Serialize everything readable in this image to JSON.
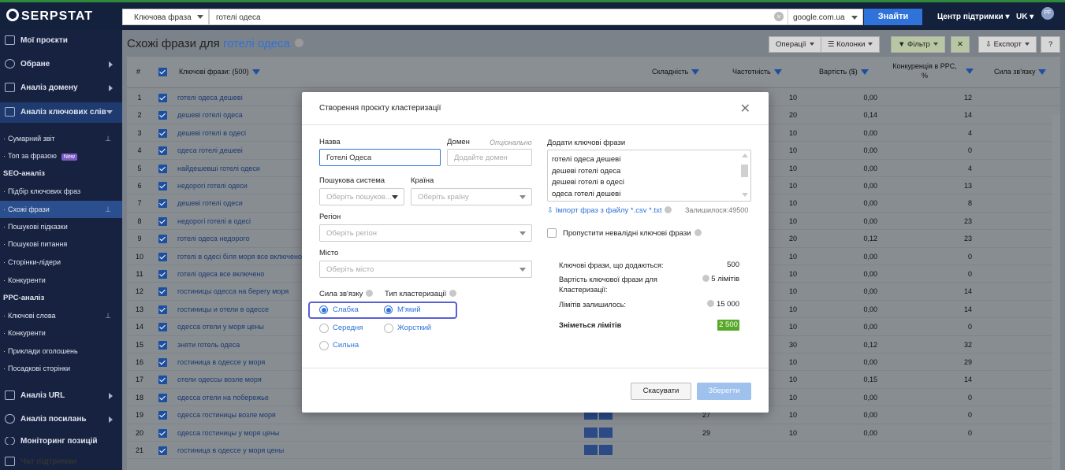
{
  "app": {
    "logo": "SERPSTAT"
  },
  "topbar": {
    "search_type": "Ключова фраза",
    "search_query": "готелі одеса",
    "search_engine": "google.com.ua",
    "find_label": "Знайти",
    "support_label": "Центр підтримки",
    "lang_label": "UK",
    "avatar": "PF"
  },
  "sidebar": {
    "my_projects": "Мої проєкти",
    "favorites": "Обране",
    "domain_analysis": "Аналіз домену",
    "keyword_analysis": "Аналіз ключових слів",
    "summary": "Сумарний звіт",
    "top_by_phrase": "Топ за фразою",
    "new_badge": "New",
    "seo_section": "SEO-аналіз",
    "keyword_selection": "Підбір ключових фраз",
    "similar_phrases": "Схожі фрази",
    "search_suggestions": "Пошукові підказки",
    "search_questions": "Пошукові питання",
    "leader_pages": "Сторінки-лідери",
    "competitors": "Конкуренти",
    "ppc_section": "PPC-аналіз",
    "keywords": "Ключові слова",
    "ppc_competitors": "Конкуренти",
    "ad_examples": "Приклади оголошень",
    "landing_pages": "Посадкові сторінки",
    "url_analysis": "Аналіз URL",
    "link_analysis": "Аналіз посилань",
    "position_monitoring": "Моніторинг позицій",
    "support_chat": "Чат підтримки"
  },
  "page": {
    "title_prefix": "Схожі фрази для",
    "title_keyword": "готелі одеса",
    "operations": "Операції",
    "columns": "Колонки",
    "filter": "Фільтр",
    "filter_clear": "✕",
    "export": "Експорт",
    "help": "?"
  },
  "table": {
    "headers": {
      "num": "#",
      "keywords": "Ключові фрази: (500)",
      "difficulty": "Складність",
      "frequency": "Частотність",
      "cost": "Вартість ($)",
      "ppc_competition": "Конкуренція в PPC, %",
      "link_strength": "Сила зв'язку"
    },
    "rows": [
      {
        "n": "1",
        "kw": "готелі одеса дешеві",
        "freq": "10",
        "cost": "0,00",
        "comp": "12"
      },
      {
        "n": "2",
        "kw": "дешеві готелі одеса",
        "freq": "20",
        "cost": "0,14",
        "comp": "14"
      },
      {
        "n": "3",
        "kw": "дешеві готелі в одесі",
        "freq": "10",
        "cost": "0,00",
        "comp": "4"
      },
      {
        "n": "4",
        "kw": "одеса готелі дешеві",
        "freq": "10",
        "cost": "0,00",
        "comp": "0"
      },
      {
        "n": "5",
        "kw": "найдешевші готелі одеси",
        "freq": "10",
        "cost": "0,00",
        "comp": "4"
      },
      {
        "n": "6",
        "kw": "недорогі готелі одеси",
        "freq": "10",
        "cost": "0,00",
        "comp": "13"
      },
      {
        "n": "7",
        "kw": "дешеві готелі одеси",
        "freq": "10",
        "cost": "0,00",
        "comp": "8"
      },
      {
        "n": "8",
        "kw": "недорогі готелі в одесі",
        "freq": "10",
        "cost": "0,00",
        "comp": "23"
      },
      {
        "n": "9",
        "kw": "готелі одеса недорого",
        "freq": "20",
        "cost": "0,12",
        "comp": "23"
      },
      {
        "n": "10",
        "kw": "готелі в одесі біля моря все включено",
        "freq": "10",
        "cost": "0,00",
        "comp": "0"
      },
      {
        "n": "11",
        "kw": "готелі одеса все включено",
        "freq": "10",
        "cost": "0,00",
        "comp": "0"
      },
      {
        "n": "12",
        "kw": "гостиницы одесса на берегу моря",
        "freq": "10",
        "cost": "0,00",
        "comp": "14"
      },
      {
        "n": "13",
        "kw": "гостиницы и отели в одессе",
        "freq": "10",
        "cost": "0,00",
        "comp": "14"
      },
      {
        "n": "14",
        "kw": "одесса отели у моря цены",
        "freq": "10",
        "cost": "0,00",
        "comp": "0"
      },
      {
        "n": "15",
        "kw": "зняти готель одеса",
        "freq": "30",
        "cost": "0,12",
        "comp": "32"
      },
      {
        "n": "16",
        "kw": "гостиница в одессе у моря",
        "freq": "10",
        "cost": "0,00",
        "comp": "29"
      },
      {
        "n": "17",
        "kw": "отели одессы возле моря",
        "freq": "10",
        "cost": "0,15",
        "comp": "14"
      },
      {
        "n": "18",
        "kw": "одесса отели на побережье",
        "freq": "10",
        "cost": "0,00",
        "comp": "0"
      },
      {
        "n": "19",
        "kw": "одесса гостиницы возле моря",
        "diff": "27",
        "freq": "10",
        "cost": "0,00",
        "comp": "0"
      },
      {
        "n": "20",
        "kw": "одесса гостиницы у моря цены",
        "diff": "29",
        "freq": "10",
        "cost": "0,00",
        "comp": "0"
      },
      {
        "n": "21",
        "kw": "гостиница в одессе у моря цены",
        "freq": "",
        "cost": "",
        "comp": ""
      }
    ]
  },
  "modal": {
    "title": "Створення проєкту кластеризації",
    "close": "✕",
    "name_label": "Назва",
    "name_value": "Готелі Одеса",
    "domain_label": "Домен",
    "domain_optional": "Опціонально",
    "domain_placeholder": "Додайте домен",
    "engine_label": "Пошукова система",
    "engine_placeholder": "Оберіть пошуков...",
    "country_label": "Країна",
    "country_placeholder": "Оберіть країну",
    "region_label": "Регіон",
    "region_placeholder": "Оберіть регіон",
    "city_label": "Місто",
    "city_placeholder": "Оберіть місто",
    "strength_label": "Сила зв'язку",
    "strength_options": [
      "Слабка",
      "Середня",
      "Сильна"
    ],
    "type_label": "Тип кластеризації",
    "type_options": [
      "М'який",
      "Жорсткий"
    ],
    "add_keywords_label": "Додати ключові фрази",
    "keywords_list": [
      "готелі одеса дешеві",
      "дешеві готелі одеса",
      "дешеві готелі в одесі",
      "одеса готелі дешеві"
    ],
    "import_link": "Імпорт фраз з файлу *.csv *.txt",
    "remaining": "Залишилося:49500",
    "skip_invalid": "Пропустити невалідні ключові фрази",
    "summary": {
      "added_label": "Ключові фрази, що додаються:",
      "added_value": "500",
      "cost_label": "Вартість ключової фрази для Кластеризації:",
      "cost_value": "5 лімітів",
      "limits_label": "Лімітів залишилось:",
      "limits_value": "15 000",
      "charged_label": "Зніметься лімітів",
      "charged_value": "2 500"
    },
    "cancel": "Скасувати",
    "save": "Зберегти"
  },
  "colors": {
    "accent": "#2f72d9",
    "sidebar": "#162240",
    "success": "#58a82a",
    "highlight": "#5a5fd6"
  }
}
